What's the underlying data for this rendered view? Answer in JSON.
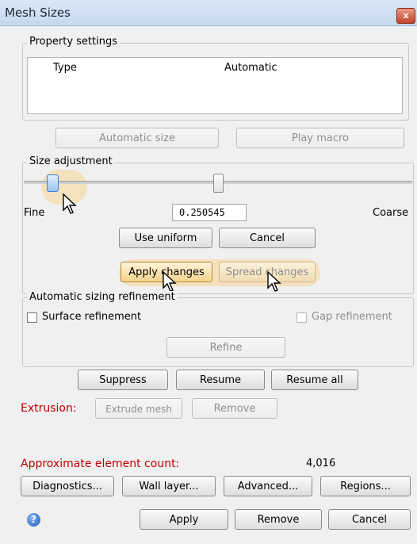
{
  "window": {
    "title": "Mesh Sizes",
    "close_glyph": "x"
  },
  "property_settings": {
    "group_title": "Property settings",
    "col_name": "Type",
    "col_value": "Automatic"
  },
  "top_buttons": {
    "automatic_size": "Automatic size",
    "play_macro": "Play macro"
  },
  "size_adjustment": {
    "group_title": "Size adjustment",
    "fine_label": "Fine",
    "coarse_label": "Coarse",
    "value": "0.250545",
    "slider_level": 0.06,
    "slider_secondary_level": 0.5
  },
  "adjust_buttons": {
    "use_uniform": "Use uniform",
    "cancel": "Cancel",
    "apply_changes": "Apply changes",
    "spread_changes": "Spread changes"
  },
  "refinement": {
    "group_title": "Automatic sizing refinement",
    "surface": "Surface refinement",
    "gap": "Gap refinement",
    "refine": "Refine"
  },
  "suppress_row": {
    "suppress": "Suppress",
    "resume": "Resume",
    "resume_all": "Resume all"
  },
  "extrusion": {
    "label": "Extrusion:",
    "extrude_mesh": "Extrude mesh",
    "remove": "Remove"
  },
  "count": {
    "label": "Approximate element count:",
    "value": "4,016"
  },
  "bottom_buttons": {
    "diagnostics": "Diagnostics...",
    "wall_layer": "Wall layer...",
    "advanced": "Advanced...",
    "regions": "Regions..."
  },
  "footer": {
    "help_glyph": "?",
    "apply": "Apply",
    "remove": "Remove",
    "cancel": "Cancel"
  },
  "colors": {
    "accent_red": "#c00000",
    "highlight": "#f7d694",
    "title_bar": "#c6d8ef"
  }
}
